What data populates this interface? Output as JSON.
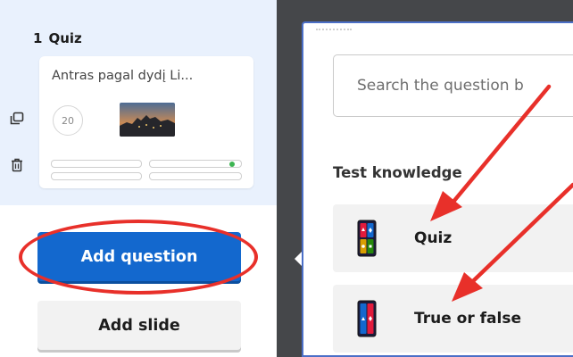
{
  "sidebar": {
    "slide_number": "1",
    "slide_type": "Quiz",
    "thumbnail": {
      "title": "Antras pagal dydį Li...",
      "timer": "20"
    },
    "add_question_label": "Add question",
    "add_slide_label": "Add slide"
  },
  "question_panel": {
    "search_placeholder": "Search the question b",
    "section_title": "Test knowledge",
    "types": [
      {
        "label": "Quiz",
        "icon": "quiz-icon"
      },
      {
        "label": "True or false",
        "icon": "true-false-icon"
      }
    ]
  },
  "colors": {
    "primary_blue": "#1368ce",
    "highlight_red": "#e8302a",
    "backdrop": "#45474a",
    "panel_border": "#4b6fc7",
    "slide_panel_bg": "#e9f1fd"
  }
}
